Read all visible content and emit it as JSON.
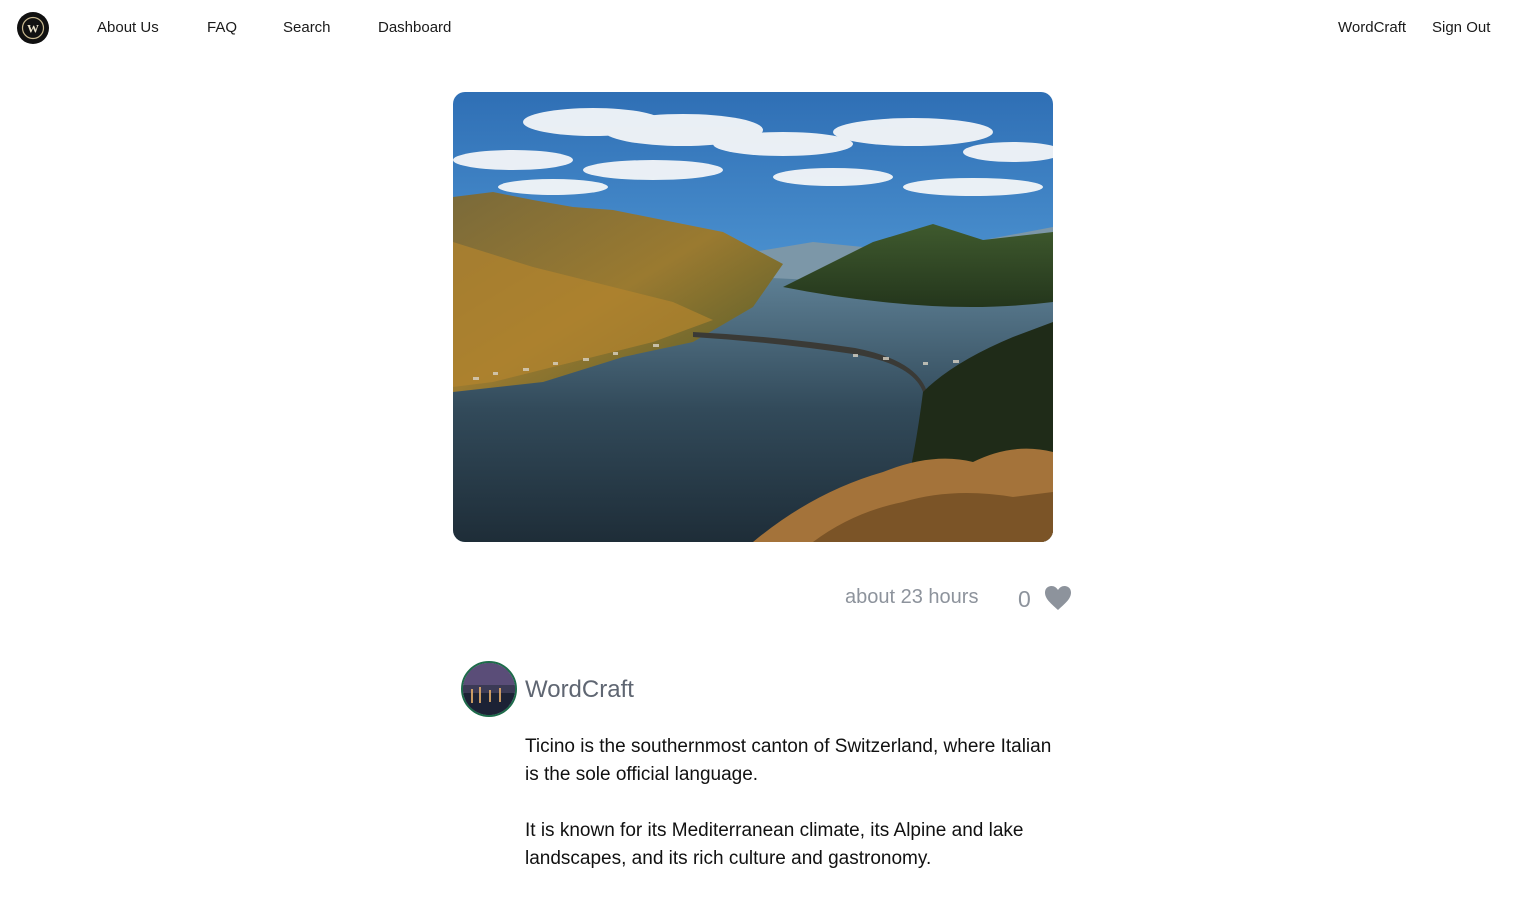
{
  "brand": {
    "logo_letter": "W",
    "logo_icon": "wordcraft-logo-icon"
  },
  "nav": {
    "left": [
      "About Us",
      "FAQ",
      "Search",
      "Dashboard"
    ],
    "right": [
      "WordCraft",
      "Sign Out"
    ]
  },
  "post": {
    "image_icon": "lake-mountain-landscape-image",
    "timestamp": "about 23 hours",
    "likes": "0",
    "like_icon": "heart-icon",
    "author": {
      "name": "WordCraft",
      "avatar_icon": "author-avatar"
    },
    "paragraphs": [
      "Ticino is the southernmost canton of Switzerland, where Italian is the sole official language.",
      "It is known for its Mediterranean climate, its Alpine and lake landscapes, and its rich culture and gastronomy."
    ]
  },
  "colors": {
    "muted_text": "#8d939c",
    "author_text": "#5f6672",
    "avatar_ring": "#1d6b4a"
  }
}
